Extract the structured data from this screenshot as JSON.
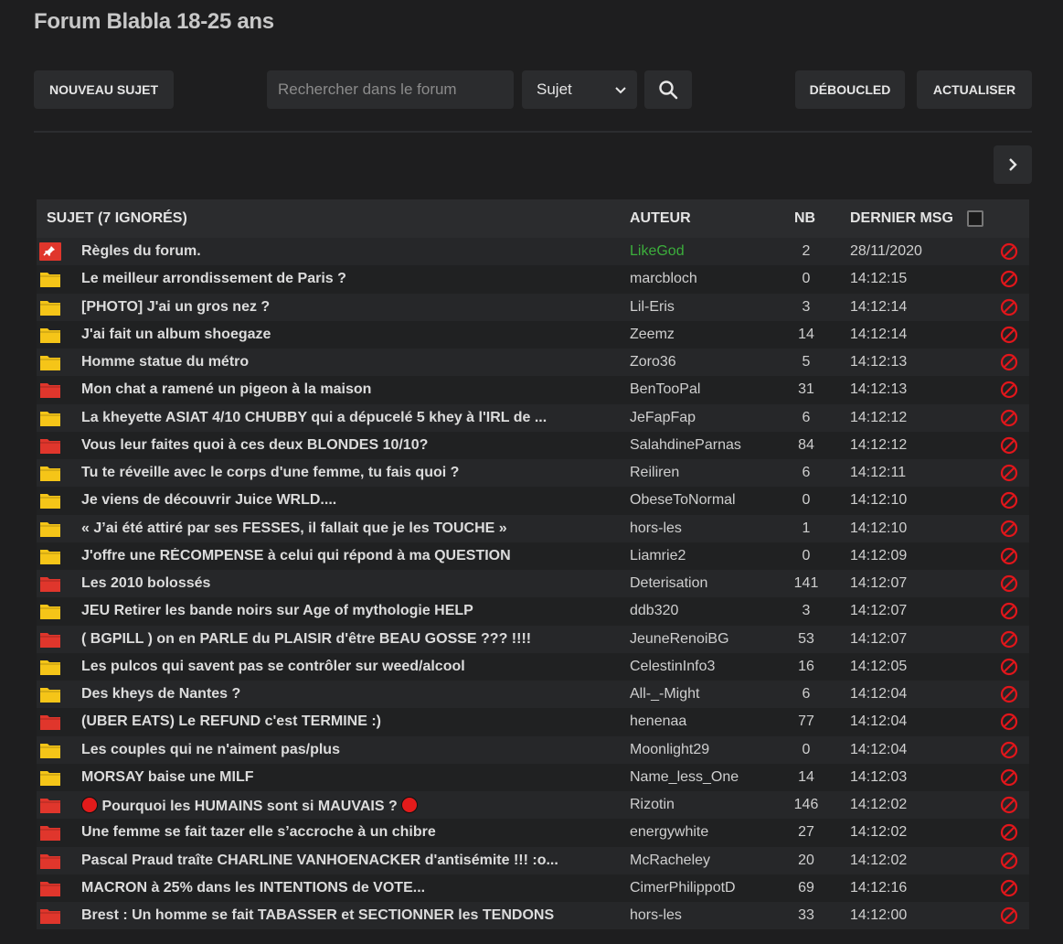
{
  "header": {
    "title": "Forum Blabla 18-25 ans"
  },
  "toolbar": {
    "new_topic": "NOUVEAU SUJET",
    "search_placeholder": "Rechercher dans le forum",
    "search_scope": "Sujet",
    "deboucled": "DÉBOUCLED",
    "refresh": "ACTUALISER"
  },
  "table": {
    "headers": {
      "subject": "SUJET (7 IGNORÉS)",
      "author": "AUTEUR",
      "count": "NB",
      "last": "DERNIER MSG"
    },
    "rows": [
      {
        "icon": "pinned",
        "subject": "Règles du forum.",
        "author": "LikeGod",
        "author_color": "green",
        "nb": "2",
        "last": "28/11/2020"
      },
      {
        "icon": "folder-yellow",
        "subject": "Le meilleur arrondissement de Paris ?",
        "author": "marcbloch",
        "nb": "0",
        "last": "14:12:15"
      },
      {
        "icon": "folder-yellow",
        "subject": "[PHOTO] J'ai un gros nez ?",
        "author": "Lil-Eris",
        "nb": "3",
        "last": "14:12:14"
      },
      {
        "icon": "folder-yellow",
        "subject": "J'ai fait un album shoegaze",
        "author": "Zeemz",
        "nb": "14",
        "last": "14:12:14"
      },
      {
        "icon": "folder-yellow",
        "subject": "Homme statue du métro",
        "author": "Zoro36",
        "nb": "5",
        "last": "14:12:13"
      },
      {
        "icon": "folder-red",
        "subject": "Mon chat a ramené un pigeon à la maison",
        "author": "BenTooPal",
        "nb": "31",
        "last": "14:12:13"
      },
      {
        "icon": "folder-yellow",
        "subject": "La kheyette ASIAT 4/10 CHUBBY qui a dépucelé 5 khey à l'IRL de ...",
        "author": "JeFapFap",
        "nb": "6",
        "last": "14:12:12"
      },
      {
        "icon": "folder-red",
        "subject": "Vous leur faites quoi à ces deux BLONDES 10/10?",
        "author": "SalahdineParnas",
        "nb": "84",
        "last": "14:12:12"
      },
      {
        "icon": "folder-yellow",
        "subject": "Tu te réveille avec le corps d'une femme, tu fais quoi ?",
        "author": "Reiliren",
        "nb": "6",
        "last": "14:12:11"
      },
      {
        "icon": "folder-yellow",
        "subject": "Je viens de découvrir Juice WRLD....",
        "author": "ObeseToNormal",
        "nb": "0",
        "last": "14:12:10"
      },
      {
        "icon": "folder-yellow",
        "subject": "« J’ai été attiré par ses FESSES, il fallait que je les TOUCHE »",
        "author": "hors-les",
        "nb": "1",
        "last": "14:12:10"
      },
      {
        "icon": "folder-yellow",
        "subject": "J'offre une RÉCOMPENSE à celui qui répond à ma QUESTION",
        "author": "Liamrie2",
        "nb": "0",
        "last": "14:12:09"
      },
      {
        "icon": "folder-red",
        "subject": "Les 2010 bolossés",
        "author": "Deterisation",
        "nb": "141",
        "last": "14:12:07"
      },
      {
        "icon": "folder-yellow",
        "subject": "JEU Retirer les bande noirs sur Age of mythologie HELP",
        "author": "ddb320",
        "nb": "3",
        "last": "14:12:07"
      },
      {
        "icon": "folder-red",
        "subject": "( BGPILL ) on en PARLE du PLAISIR d'être BEAU GOSSE ??? !!!!",
        "author": "JeuneRenoiBG",
        "nb": "53",
        "last": "14:12:07"
      },
      {
        "icon": "folder-yellow",
        "subject": "Les pulcos qui savent pas se contrôler sur weed/alcool",
        "author": "CelestinInfo3",
        "nb": "16",
        "last": "14:12:05"
      },
      {
        "icon": "folder-yellow",
        "subject": "Des kheys de Nantes ?",
        "author": "All-_-Might",
        "nb": "6",
        "last": "14:12:04"
      },
      {
        "icon": "folder-red",
        "subject": "(UBER EATS) Le REFUND c'est TERMINE :)",
        "author": "henenaa",
        "nb": "77",
        "last": "14:12:04"
      },
      {
        "icon": "folder-yellow",
        "subject": "Les couples qui ne n'aiment pas/plus",
        "author": "Moonlight29",
        "nb": "0",
        "last": "14:12:04"
      },
      {
        "icon": "folder-yellow",
        "subject": "MORSAY baise une MILF",
        "author": "Name_less_One",
        "nb": "14",
        "last": "14:12:03"
      },
      {
        "icon": "folder-red",
        "subject": "Pourquoi les HUMAINS sont si MAUVAIS ?",
        "dots": true,
        "author": "Rizotin",
        "nb": "146",
        "last": "14:12:02"
      },
      {
        "icon": "folder-red",
        "subject": "Une femme se fait tazer elle s’accroche à un chibre",
        "author": "energywhite",
        "nb": "27",
        "last": "14:12:02"
      },
      {
        "icon": "folder-red",
        "subject": "Pascal Praud traîte CHARLINE VANHOENACKER d'antisémite !!! :o...",
        "author": "McRacheley",
        "nb": "20",
        "last": "14:12:02"
      },
      {
        "icon": "folder-red",
        "subject": "MACRON à 25% dans les INTENTIONS de VOTE...",
        "author": "CimerPhilippotD",
        "nb": "69",
        "last": "14:12:16"
      },
      {
        "icon": "folder-red",
        "subject": "Brest : Un homme se fait TABASSER et SECTIONNER les TENDONS",
        "author": "hors-les",
        "nb": "33",
        "last": "14:12:00"
      }
    ]
  },
  "colors": {
    "folder_yellow": "#f5c518",
    "folder_red": "#e0362c",
    "ban": "#e0161b",
    "author_green": "#3cae3c"
  }
}
